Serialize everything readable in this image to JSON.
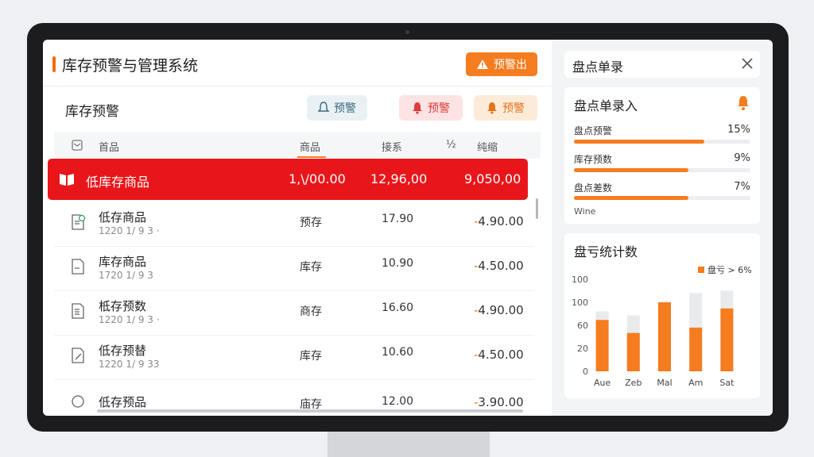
{
  "app": {
    "title": "库存预警与管理系统",
    "alert_button": "预警出"
  },
  "inventory": {
    "title": "库存预警",
    "pills": [
      "预警",
      "预警",
      "预警"
    ],
    "headers": [
      "首品",
      "商品",
      "接系",
      "½",
      "纯缩"
    ],
    "highlight": {
      "name": "低库存商品",
      "c2": "1,\\/00.00",
      "c3": "12,96,00",
      "c4": "9,050,00"
    },
    "rows": [
      {
        "name": "低存商品",
        "sub": "1220 1/ 9 3 ·",
        "c2": "预存",
        "c3": "17.90",
        "c4_sign": "-",
        "c4": "4.90.00",
        "icon": "doc-check-icon"
      },
      {
        "name": "库存商品",
        "sub": "1720 1/ 9 3",
        "c2": "库存",
        "c3": "10.90",
        "c4_sign": "-",
        "c4": "4.50.00",
        "icon": "doc-icon"
      },
      {
        "name": "柢存预数",
        "sub": "1220 1/ 9 3 ·",
        "c2": "商存",
        "c3": "16.60",
        "c4_sign": "-",
        "c4": "4.90.00",
        "icon": "doc-lines-icon"
      },
      {
        "name": "低存预替",
        "sub": "1220 1/ 9 33",
        "c2": "库存",
        "c3": "10.60",
        "c4_sign": "-",
        "c4": "4.50.00",
        "icon": "doc-edit-icon"
      },
      {
        "name": "低存预品",
        "sub": "",
        "c2": "庙存",
        "c3": "12.00",
        "c4_sign": "-",
        "c4": "3.90.00",
        "icon": "circle-icon"
      }
    ]
  },
  "sidebar": {
    "title": "盘点单录",
    "entry": {
      "title": "盘点单录入",
      "stats": [
        {
          "label": "盘点预警",
          "value": "15%",
          "fill": 0.74
        },
        {
          "label": "库存预数",
          "value": "9%",
          "fill": 0.65
        },
        {
          "label": "盘点差数",
          "value": "7%",
          "fill": 0.65
        }
      ],
      "footnote": "Wine"
    },
    "stats_card": {
      "title": "盘亏统计数",
      "legend": "盘亏 > 6%"
    }
  },
  "chart_data": {
    "type": "bar",
    "categories": [
      "Aue",
      "Zeb",
      "Mal",
      "Am",
      "Sat"
    ],
    "series": [
      {
        "name": "盘亏 > 6%",
        "values": [
          67,
          50,
          90,
          57,
          82
        ]
      }
    ],
    "background_values": [
      78,
      73,
      90,
      102,
      105
    ],
    "yticks": [
      "100",
      "100",
      "60",
      "20",
      "0"
    ],
    "ylim": [
      0,
      120
    ],
    "colors": {
      "bar": "#f57c1f",
      "background": "#e9eaec"
    }
  },
  "colors": {
    "accent": "#f57c1f",
    "danger": "#e8161a"
  }
}
